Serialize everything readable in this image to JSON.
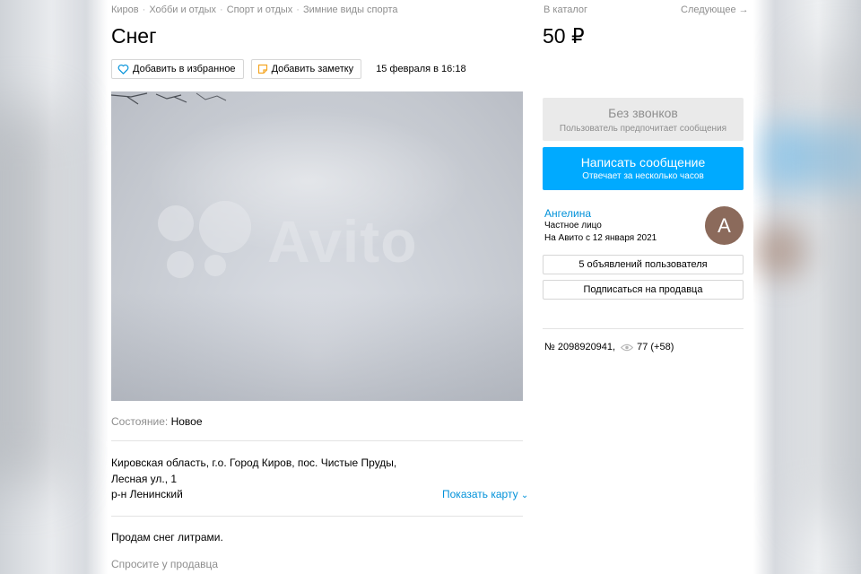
{
  "breadcrumbs": [
    "Киров",
    "Хобби и отдых",
    "Спорт и отдых",
    "Зимние виды спорта"
  ],
  "breadcrumb_separator": "·",
  "title": "Снег",
  "actions": {
    "favorite_label": "Добавить в избранное",
    "note_label": "Добавить заметку",
    "date": "15 февраля в 16:18"
  },
  "photo": {
    "watermark": "Avito"
  },
  "condition": {
    "label": "Состояние:",
    "value": "Новое"
  },
  "address": {
    "line": "Кировская область, г.о. Город Киров, пос. Чистые Пруды, Лесная ул., 1",
    "district": "р-н Ленинский",
    "map_link": "Показать карту",
    "map_chevron": "⌄"
  },
  "description": "Продам снег литрами.",
  "ask_seller": "Спросите у продавца",
  "sidebar": {
    "catalog_label": "В каталог",
    "next_label": "Следующее →",
    "price": "50 ₽",
    "no_calls": {
      "title": "Без звонков",
      "subtitle": "Пользователь предпочитает сообщения"
    },
    "write_message": {
      "title": "Написать сообщение",
      "subtitle": "Отвечает за несколько часов"
    },
    "seller": {
      "name": "Ангелина",
      "type": "Частное лицо",
      "since": "На Авито с 12 января 2021",
      "avatar_letter": "А"
    },
    "user_ads_label": "5 объявлений пользователя",
    "subscribe_label": "Подписаться на продавца",
    "ad_number": "№ 2098920941,",
    "views": "77 (+58)"
  },
  "colors": {
    "accent": "#00aaff",
    "link": "#0091d9",
    "avatar": "#8b6a5b",
    "muted": "#8e8e8e"
  }
}
